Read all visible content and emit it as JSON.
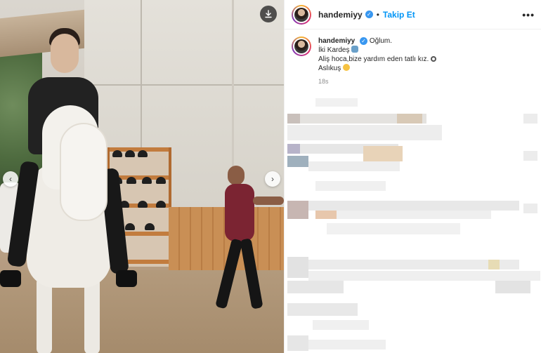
{
  "header": {
    "username": "handemiyy",
    "separator": "•",
    "follow_label": "Takip Et",
    "more_label": "•••"
  },
  "caption": {
    "username": "handemiyy",
    "lines": [
      "Oğlum.",
      "İki Kardeş",
      "Aliş hoca,bize yardım eden tatlı kız.",
      "Aslıkuş"
    ],
    "timestamp": "18s"
  },
  "icons": {
    "download": "download-icon",
    "prev": "chevron-left-icon",
    "next": "chevron-right-icon",
    "verified": "verified-badge-icon",
    "more": "more-horizontal-icon"
  },
  "colors": {
    "follow_blue": "#0095f6",
    "verified_blue": "#3897f0",
    "border": "#efefef",
    "timestamp_gray": "#8e8e8e"
  }
}
